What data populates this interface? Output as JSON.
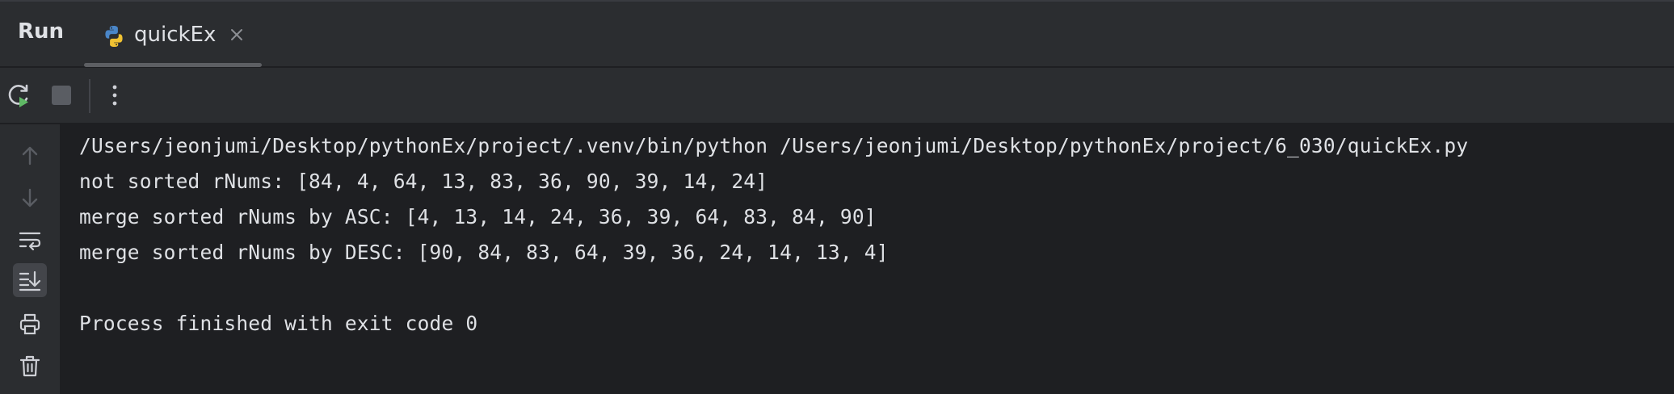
{
  "header": {
    "title": "Run",
    "tab": {
      "label": "quickEx",
      "icon": "python-icon",
      "close_icon": "close-icon"
    }
  },
  "toolbar": {
    "buttons": [
      {
        "name": "rerun",
        "icon": "rerun-icon"
      },
      {
        "name": "stop",
        "icon": "stop-icon"
      },
      {
        "name": "more",
        "icon": "more-vertical-icon"
      }
    ]
  },
  "gutter": {
    "buttons": [
      {
        "name": "up",
        "icon": "arrow-up-icon"
      },
      {
        "name": "down",
        "icon": "arrow-down-icon"
      },
      {
        "name": "soft-wrap",
        "icon": "soft-wrap-icon"
      },
      {
        "name": "scroll-to-end",
        "icon": "scroll-to-end-icon",
        "active": true
      },
      {
        "name": "print",
        "icon": "print-icon"
      },
      {
        "name": "clear",
        "icon": "trash-icon"
      }
    ]
  },
  "console": {
    "lines": [
      "/Users/jeonjumi/Desktop/pythonEx/project/.venv/bin/python /Users/jeonjumi/Desktop/pythonEx/project/6_030/quickEx.py",
      "not sorted rNums: [84, 4, 64, 13, 83, 36, 90, 39, 14, 24]",
      "merge sorted rNums by ASC: [4, 13, 14, 24, 36, 39, 64, 83, 84, 90]",
      "merge sorted rNums by DESC: [90, 84, 83, 64, 39, 36, 24, 14, 13, 4]",
      "",
      "Process finished with exit code 0"
    ]
  },
  "colors": {
    "background": "#1e1f22",
    "panel": "#2b2d30",
    "text": "#dfe1e5",
    "icon": "#ced0d6",
    "icon_disabled": "#5a5d63",
    "rerun_green": "#5fb865"
  }
}
